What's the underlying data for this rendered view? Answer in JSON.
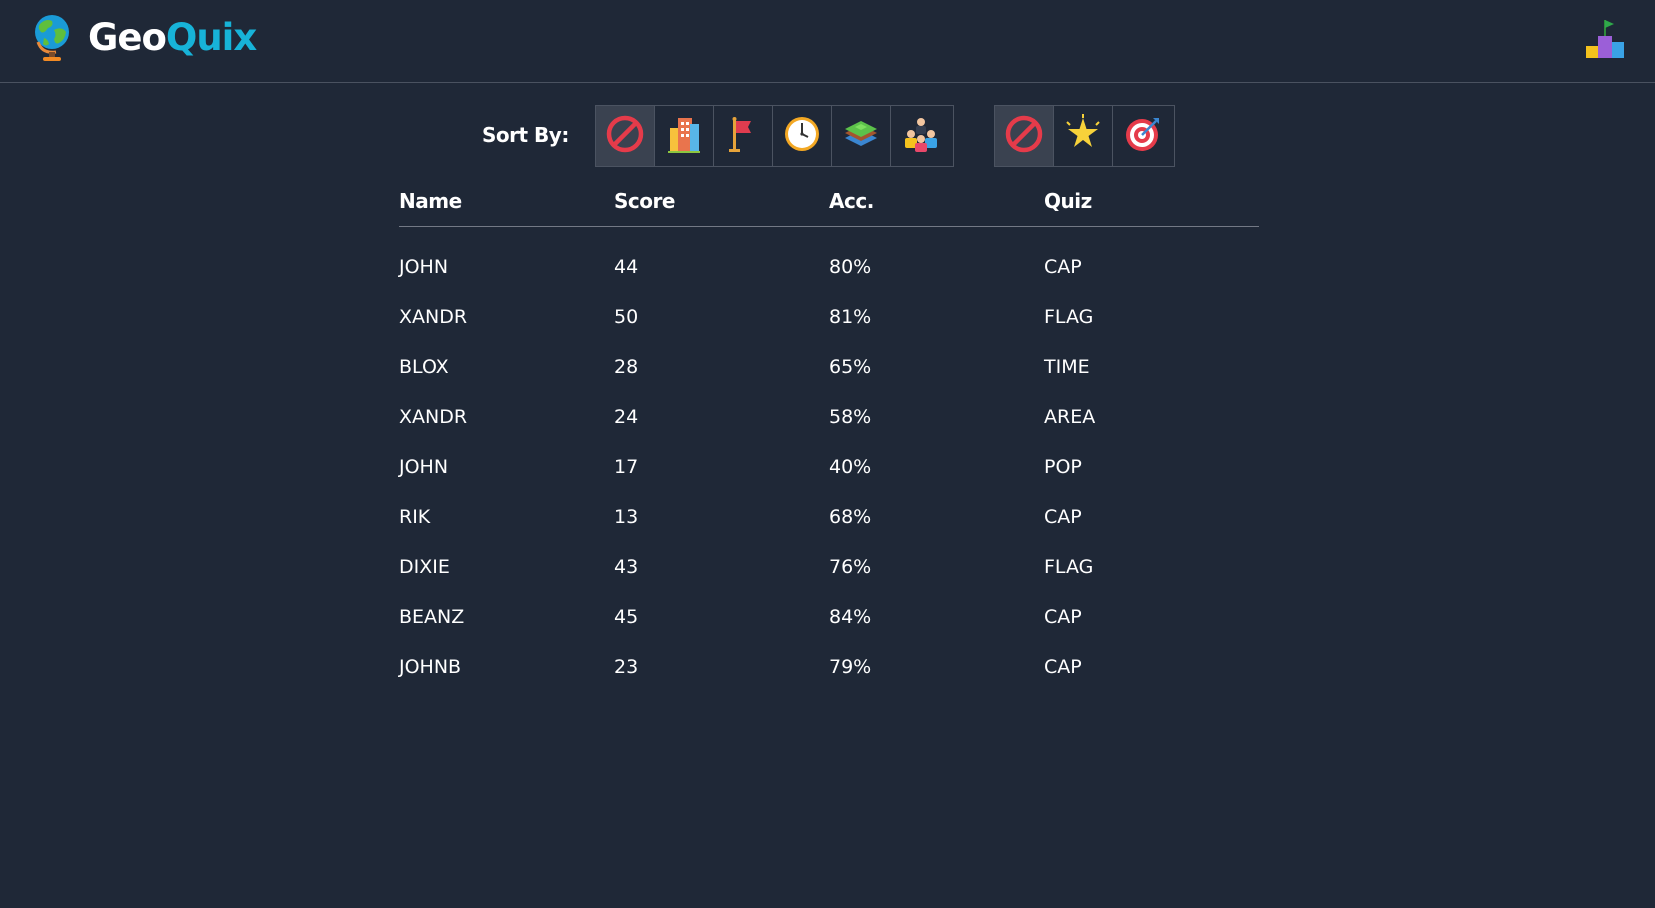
{
  "app": {
    "brand_part1": "Geo",
    "brand_part2": "Quix",
    "brand_color_secondary": "#17b3d8",
    "background_color": "#1f2837"
  },
  "header": {
    "logo_icon": "globe-icon",
    "leaderboard_icon": "podium-icon"
  },
  "sort": {
    "label": "Sort By:",
    "quiz_filters": [
      {
        "icon": "none-icon",
        "active": true
      },
      {
        "icon": "capital-building-icon",
        "active": false
      },
      {
        "icon": "flag-icon",
        "active": false
      },
      {
        "icon": "clock-icon",
        "active": false
      },
      {
        "icon": "area-layers-icon",
        "active": false
      },
      {
        "icon": "population-icon",
        "active": false
      }
    ],
    "metric_filters": [
      {
        "icon": "none-icon",
        "active": true
      },
      {
        "icon": "star-icon",
        "active": false
      },
      {
        "icon": "target-icon",
        "active": false
      }
    ]
  },
  "table": {
    "headers": {
      "name": "Name",
      "score": "Score",
      "acc": "Acc.",
      "quiz": "Quiz"
    },
    "rows": [
      {
        "name": "JOHN",
        "score": "44",
        "acc": "80%",
        "quiz": "CAP"
      },
      {
        "name": "XANDR",
        "score": "50",
        "acc": "81%",
        "quiz": "FLAG"
      },
      {
        "name": "BLOX",
        "score": "28",
        "acc": "65%",
        "quiz": "TIME"
      },
      {
        "name": "XANDR",
        "score": "24",
        "acc": "58%",
        "quiz": "AREA"
      },
      {
        "name": "JOHN",
        "score": "17",
        "acc": "40%",
        "quiz": "POP"
      },
      {
        "name": "RIK",
        "score": "13",
        "acc": "68%",
        "quiz": "CAP"
      },
      {
        "name": "DIXIE",
        "score": "43",
        "acc": "76%",
        "quiz": "FLAG"
      },
      {
        "name": "BEANZ",
        "score": "45",
        "acc": "84%",
        "quiz": "CAP"
      },
      {
        "name": "JOHNB",
        "score": "23",
        "acc": "79%",
        "quiz": "CAP"
      }
    ]
  }
}
